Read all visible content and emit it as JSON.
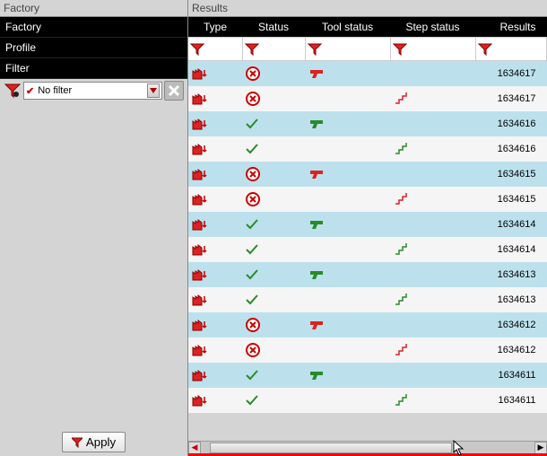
{
  "sidebar": {
    "header": "Factory",
    "nav_factory": "Factory",
    "nav_profile": "Profile",
    "nav_filter": "Filter",
    "filter_label": "No filter",
    "apply_label": "Apply"
  },
  "results": {
    "header": "Results",
    "columns": {
      "type": "Type",
      "status": "Status",
      "tool": "Tool status",
      "step": "Step status",
      "results": "Results"
    },
    "rows": [
      {
        "type": "factory-down",
        "status": "fail",
        "tool": "gun-red",
        "step": "",
        "result": "1634617"
      },
      {
        "type": "factory-down",
        "status": "fail",
        "tool": "",
        "step": "step-red",
        "result": "1634617"
      },
      {
        "type": "factory-down",
        "status": "ok",
        "tool": "gun-green",
        "step": "",
        "result": "1634616"
      },
      {
        "type": "factory-down",
        "status": "ok",
        "tool": "",
        "step": "step-green",
        "result": "1634616"
      },
      {
        "type": "factory-down",
        "status": "fail",
        "tool": "gun-red",
        "step": "",
        "result": "1634615"
      },
      {
        "type": "factory-down",
        "status": "fail",
        "tool": "",
        "step": "step-red",
        "result": "1634615"
      },
      {
        "type": "factory-down",
        "status": "ok",
        "tool": "gun-green",
        "step": "",
        "result": "1634614"
      },
      {
        "type": "factory-down",
        "status": "ok",
        "tool": "",
        "step": "step-green",
        "result": "1634614"
      },
      {
        "type": "factory-down",
        "status": "ok",
        "tool": "gun-green",
        "step": "",
        "result": "1634613"
      },
      {
        "type": "factory-down",
        "status": "ok",
        "tool": "",
        "step": "step-green",
        "result": "1634613"
      },
      {
        "type": "factory-down",
        "status": "fail",
        "tool": "gun-red",
        "step": "",
        "result": "1634612"
      },
      {
        "type": "factory-down",
        "status": "fail",
        "tool": "",
        "step": "step-red",
        "result": "1634612"
      },
      {
        "type": "factory-down",
        "status": "ok",
        "tool": "gun-green",
        "step": "",
        "result": "1634611"
      },
      {
        "type": "factory-down",
        "status": "ok",
        "tool": "",
        "step": "step-green",
        "result": "1634611"
      }
    ]
  },
  "icons": {
    "funnel_red": "funnel",
    "check_red": "✔",
    "x_mark": "✖"
  }
}
